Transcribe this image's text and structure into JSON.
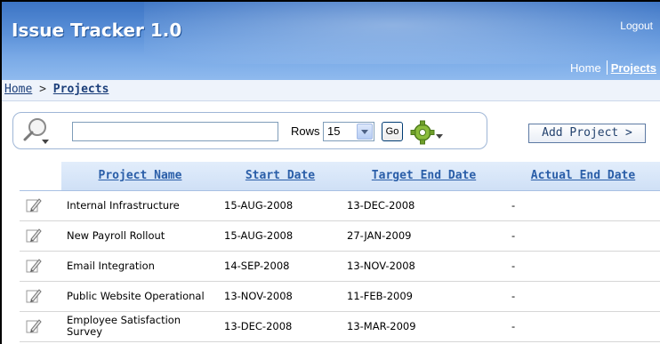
{
  "app": {
    "title": "Issue Tracker 1.0",
    "logout": "Logout",
    "nav": {
      "home": "Home",
      "projects": "Projects"
    }
  },
  "breadcrumb": {
    "home": "Home",
    "separator": ">",
    "current": "Projects"
  },
  "search": {
    "icon": "search-icon",
    "input_value": "",
    "rows_label": "Rows",
    "rows_value": "15",
    "go_label": "Go",
    "actions_icon": "gear-icon"
  },
  "add_project_label": "Add Project >",
  "table": {
    "columns": [
      "Project Name",
      "Start Date",
      "Target End Date",
      "Actual End Date"
    ],
    "rows": [
      {
        "name": "Internal Infrastructure",
        "start": "15-AUG-2008",
        "target": "13-DEC-2008",
        "actual": "-"
      },
      {
        "name": "New Payroll Rollout",
        "start": "15-AUG-2008",
        "target": "27-JAN-2009",
        "actual": "-"
      },
      {
        "name": "Email Integration",
        "start": "14-SEP-2008",
        "target": "13-NOV-2008",
        "actual": "-"
      },
      {
        "name": "Public Website Operational",
        "start": "13-NOV-2008",
        "target": "11-FEB-2009",
        "actual": "-"
      },
      {
        "name": "Employee Satisfaction Survey",
        "start": "13-DEC-2008",
        "target": "13-MAR-2009",
        "actual": "-"
      }
    ]
  },
  "colors": {
    "header": "#5a90d8",
    "link": "#2a5ea8",
    "table_header": "#d8e6f8"
  }
}
